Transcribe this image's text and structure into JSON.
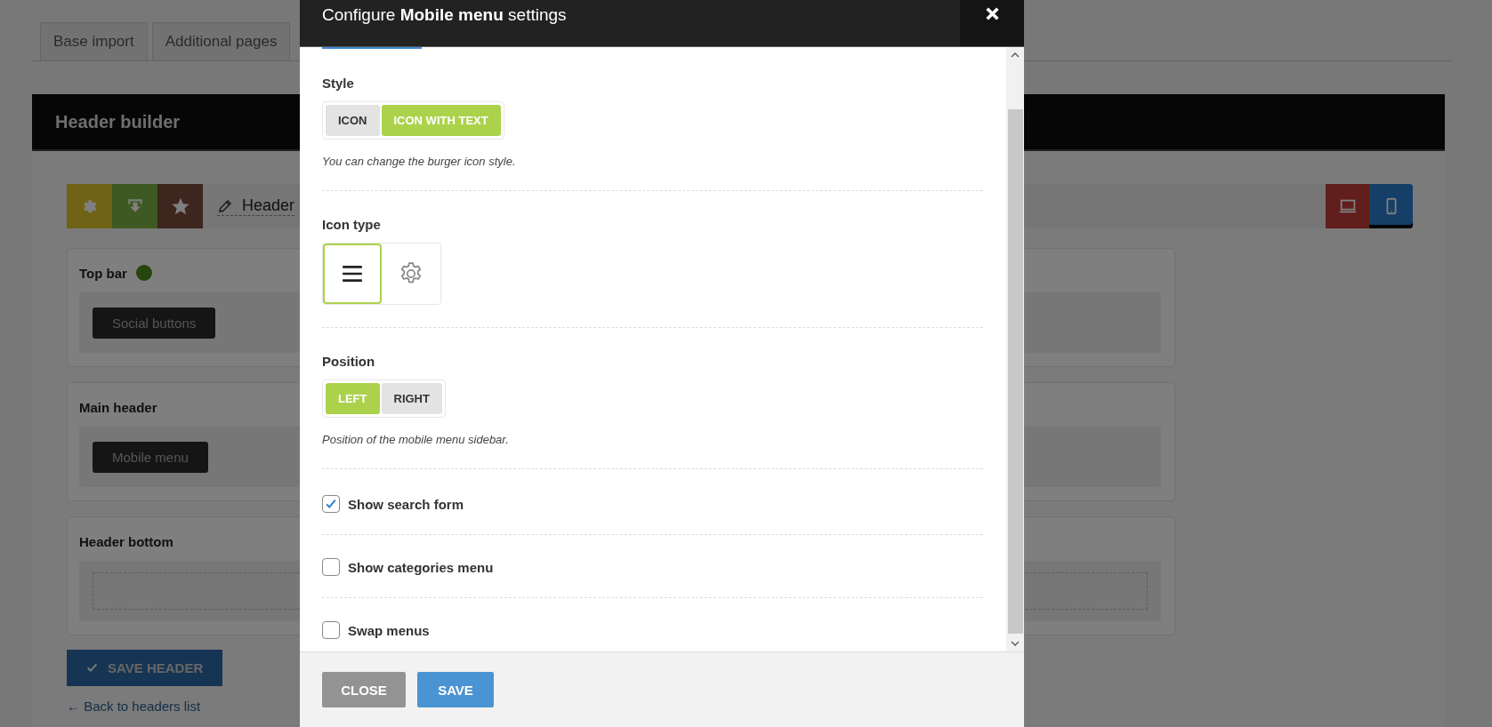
{
  "tabs": [
    {
      "label": "Base import"
    },
    {
      "label": "Additional pages"
    }
  ],
  "builder": {
    "title": "Header builder",
    "tools": [
      {
        "kind": "settings"
      },
      {
        "kind": "import"
      },
      {
        "kind": "star"
      }
    ],
    "header_name": "Header",
    "devices": [
      {
        "kind": "desktop",
        "selected": false
      },
      {
        "kind": "mobile",
        "selected": true
      }
    ],
    "rows": [
      {
        "title": "Top bar",
        "dot": true,
        "elements": [
          "Social buttons"
        ]
      },
      {
        "title": "Main header",
        "dot": false,
        "elements": [
          "Mobile menu"
        ]
      },
      {
        "title": "Header bottom",
        "dot": false
      }
    ],
    "save_button": "SAVE HEADER",
    "back_link": "← Back to headers list"
  },
  "modal": {
    "title": "Configure **Mobile menu** settings",
    "fields": [
      {
        "kind": "toggle",
        "label": "Style",
        "options": [
          {
            "label": "ICON",
            "selected": false
          },
          {
            "label": "ICON WITH TEXT",
            "selected": true
          }
        ],
        "hint": "You can change the burger icon style."
      },
      {
        "kind": "icon_picker",
        "label": "Icon type",
        "options": [
          {
            "kind": "burger",
            "selected": true
          },
          {
            "kind": "gear",
            "selected": false
          }
        ]
      },
      {
        "kind": "toggle",
        "label": "Position",
        "options": [
          {
            "label": "LEFT",
            "selected": true
          },
          {
            "label": "RIGHT",
            "selected": false
          }
        ],
        "hint": "Position of the mobile menu sidebar."
      },
      {
        "kind": "checkbox",
        "label": "Show search form",
        "checked": true
      },
      {
        "kind": "checkbox",
        "label": "Show categories menu",
        "checked": false
      },
      {
        "kind": "checkbox",
        "label": "Swap menus",
        "checked": false
      }
    ],
    "buttons": [
      {
        "kind": "close",
        "label": "CLOSE"
      },
      {
        "kind": "save",
        "label": "SAVE"
      }
    ]
  }
}
